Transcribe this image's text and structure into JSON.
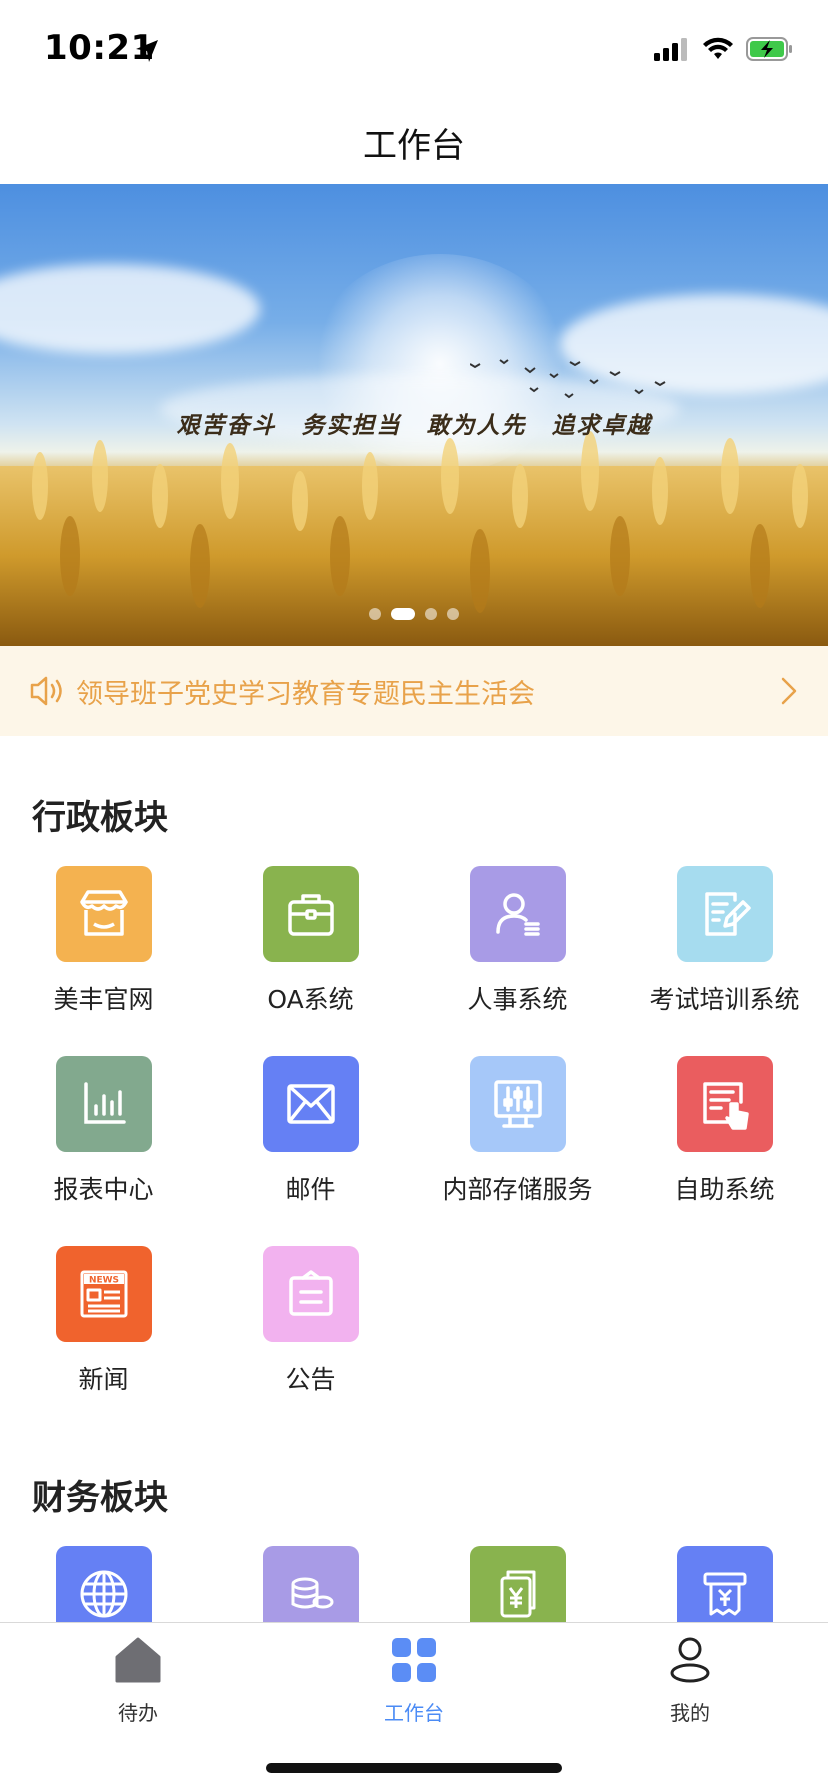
{
  "status_bar": {
    "time": "10:21"
  },
  "header": {
    "title": "工作台"
  },
  "banner": {
    "slogan": "艰苦奋斗　务实担当　敢为人先　追求卓越",
    "dots": 4,
    "active_dot": 1
  },
  "notice": {
    "text": "领导班子党史学习教育专题民主生活会"
  },
  "sections": {
    "admin": {
      "title": "行政板块",
      "items": [
        {
          "label": "美丰官网",
          "icon": "store-icon",
          "color": "#f4b250"
        },
        {
          "label": "OA系统",
          "icon": "briefcase-icon",
          "color": "#89b34e"
        },
        {
          "label": "人事系统",
          "icon": "person-list-icon",
          "color": "#a89be6"
        },
        {
          "label": "考试培训系统",
          "icon": "edit-doc-icon",
          "color": "#a6dcef"
        },
        {
          "label": "报表中心",
          "icon": "bar-chart-icon",
          "color": "#82a98e"
        },
        {
          "label": "邮件",
          "icon": "envelope-icon",
          "color": "#6580f4"
        },
        {
          "label": "内部存储服务",
          "icon": "server-monitor-icon",
          "color": "#a6c8f9"
        },
        {
          "label": "自助系统",
          "icon": "self-service-icon",
          "color": "#ea5d5f"
        },
        {
          "label": "新闻",
          "icon": "news-icon",
          "color": "#f0632d"
        },
        {
          "label": "公告",
          "icon": "announcement-icon",
          "color": "#f2b2ef"
        }
      ]
    },
    "finance": {
      "title": "财务板块",
      "items": [
        {
          "label": "",
          "icon": "globe-icon",
          "color": "#6580f4"
        },
        {
          "label": "",
          "icon": "coins-icon",
          "color": "#a89be6"
        },
        {
          "label": "",
          "icon": "yuan-doc-icon",
          "color": "#89b34e"
        },
        {
          "label": "",
          "icon": "yuan-receipt-icon",
          "color": "#6580f4"
        }
      ]
    }
  },
  "tabbar": {
    "tabs": [
      {
        "label": "待办",
        "icon": "home-icon"
      },
      {
        "label": "工作台",
        "icon": "grid-icon",
        "active": true
      },
      {
        "label": "我的",
        "icon": "user-icon"
      }
    ]
  }
}
